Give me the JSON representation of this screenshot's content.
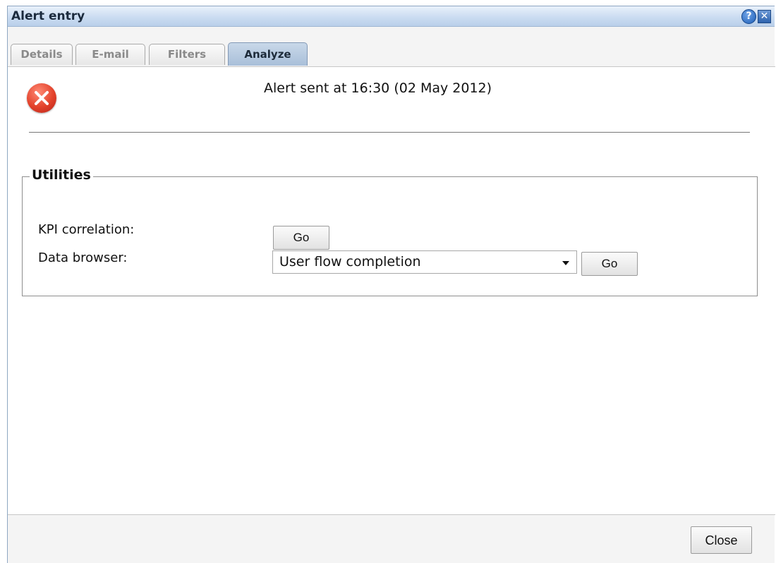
{
  "dialog": {
    "title": "Alert entry",
    "help_icon_glyph": "?",
    "close_icon_glyph": "✕"
  },
  "tabs": [
    {
      "label": "Details",
      "active": false
    },
    {
      "label": "E-mail",
      "active": false
    },
    {
      "label": "Filters",
      "active": false
    },
    {
      "label": "Analyze",
      "active": true
    }
  ],
  "status": {
    "icon": "error-icon",
    "message": "Alert sent at 16:30 (02 May 2012)"
  },
  "utilities": {
    "legend": "Utilities",
    "kpi_label": "KPI correlation:",
    "kpi_button": "Go",
    "browser_label": "Data browser:",
    "browser_selected": "User flow completion",
    "browser_button": "Go"
  },
  "footer": {
    "close_label": "Close"
  },
  "colors": {
    "title_bar": "#cbdcf1",
    "active_tab": "#b9cce2",
    "error_icon": "#e3422b"
  }
}
